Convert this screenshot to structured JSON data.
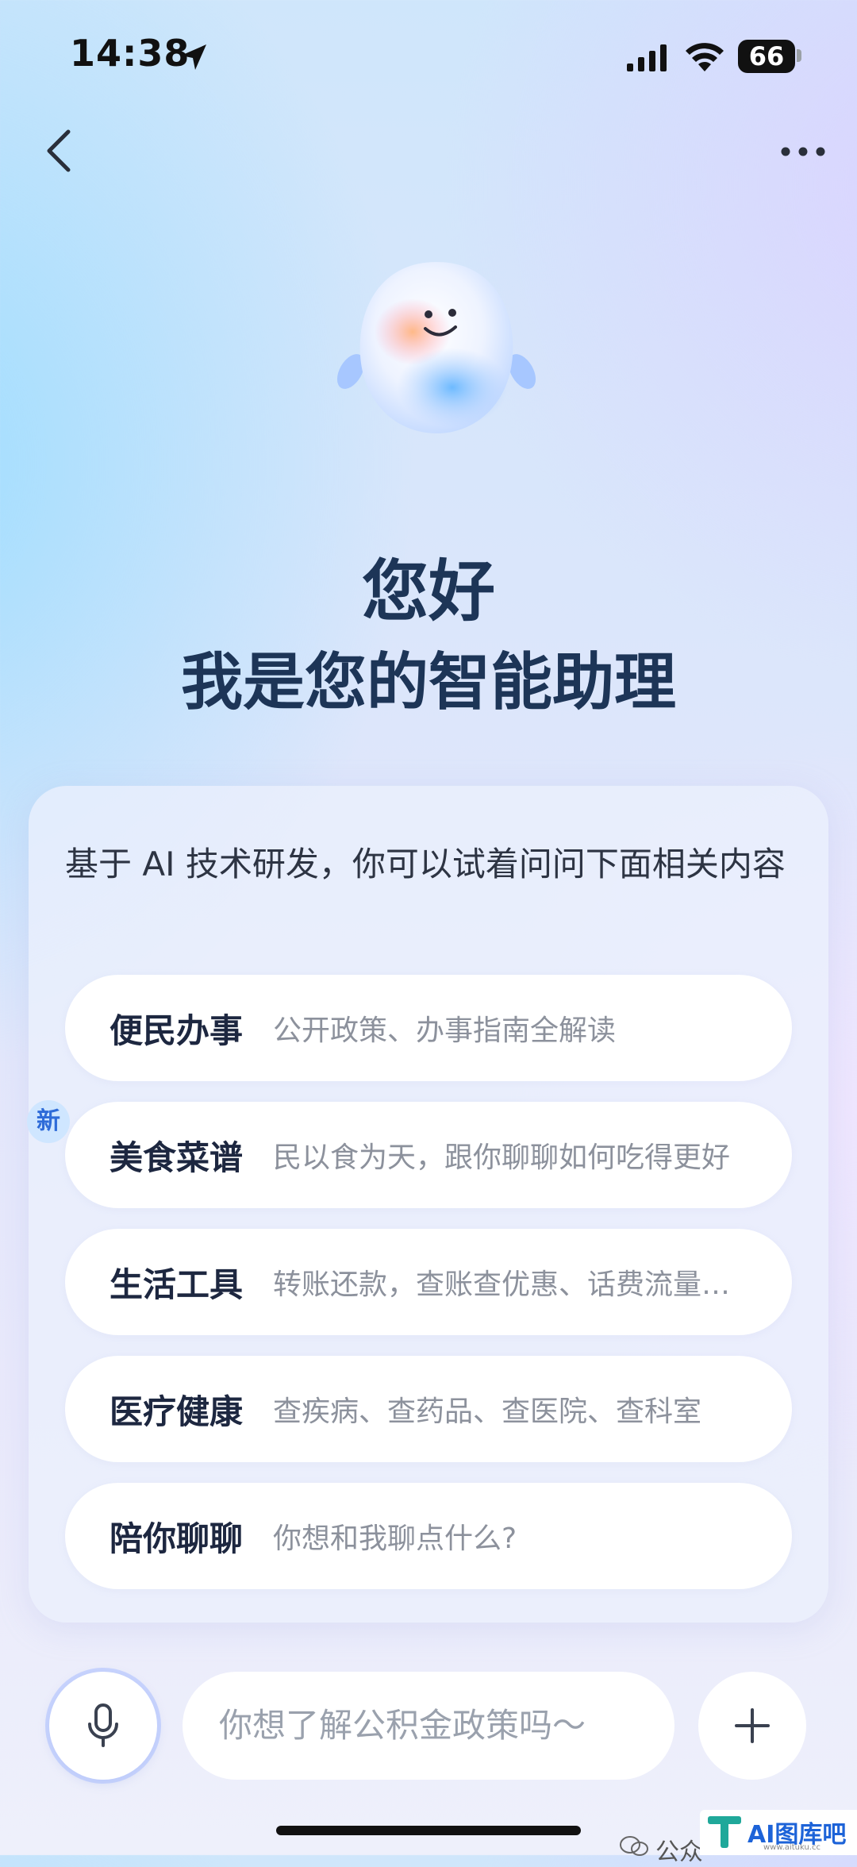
{
  "status_bar": {
    "time": "14:38",
    "battery": "66"
  },
  "nav": {
    "back_icon": "chevron-left-icon",
    "more_icon": "more-dots-icon"
  },
  "greeting": {
    "line1": "您好",
    "line2": "我是您的智能助理"
  },
  "card": {
    "intro": "基于 AI 技术研发，你可以试着问问下面相关内容",
    "items": [
      {
        "title": "便民办事",
        "desc": "公开政策、办事指南全解读"
      },
      {
        "title": "美食菜谱",
        "desc": "民以食为天，跟你聊聊如何吃得更好",
        "badge": "新"
      },
      {
        "title": "生活工具",
        "desc": "转账还款，查账查优惠、话费流量…"
      },
      {
        "title": "医疗健康",
        "desc": "查疾病、查药品、查医院、查科室"
      },
      {
        "title": "陪你聊聊",
        "desc": "你想和我聊点什么?"
      }
    ]
  },
  "input": {
    "placeholder": "你想了解公积金政策吗～"
  },
  "watermark": {
    "text": "公众",
    "logo_text": "AI图库吧",
    "logo_url": "www.aituku.cc"
  },
  "colors": {
    "title": "#1d3557",
    "badge_bg": "#cfe6ff",
    "badge_text": "#2e6bd8"
  }
}
